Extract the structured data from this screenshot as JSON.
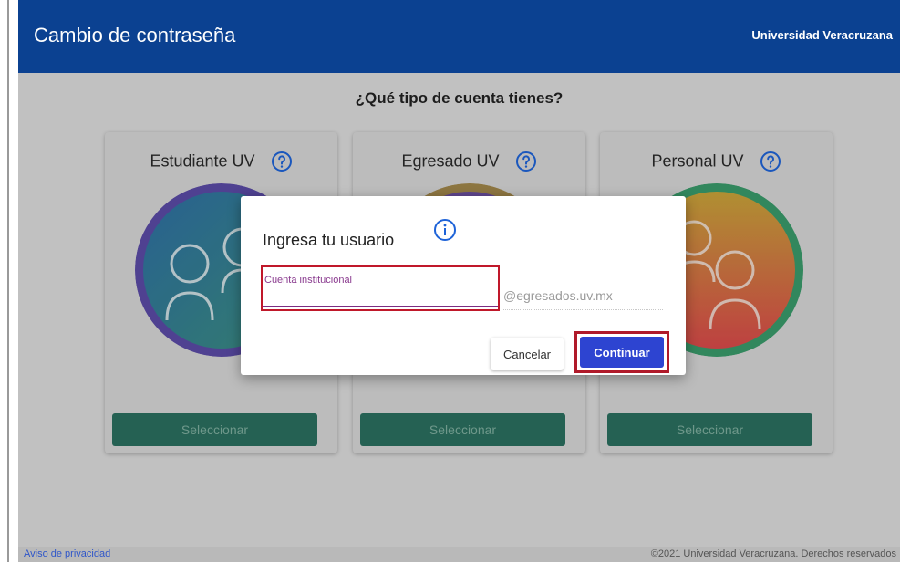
{
  "header": {
    "title": "Cambio de contraseña",
    "institution": "Universidad Veracruzana"
  },
  "prompt": "¿Qué tipo de cuenta tienes?",
  "cards": [
    {
      "title": "Estudiante UV",
      "button": "Seleccionar"
    },
    {
      "title": "Egresado UV",
      "button": "Seleccionar"
    },
    {
      "title": "Personal UV",
      "button": "Seleccionar"
    }
  ],
  "dialog": {
    "title": "Ingresa tu usuario",
    "field_placeholder": "Cuenta institucional",
    "domain_suffix": "@egresados.uv.mx",
    "cancel_label": "Cancelar",
    "continue_label": "Continuar"
  },
  "footer": {
    "privacy_link": "Aviso de privacidad",
    "copyright": "©2021 Universidad Veracruzana. Derechos reservados"
  },
  "colors": {
    "header": "#0b4191",
    "select_button": "#2b6f5f",
    "continue_button": "#2d44d1",
    "highlight": "#c0182a"
  },
  "icons": [
    "help-circle-icon",
    "info-icon"
  ]
}
